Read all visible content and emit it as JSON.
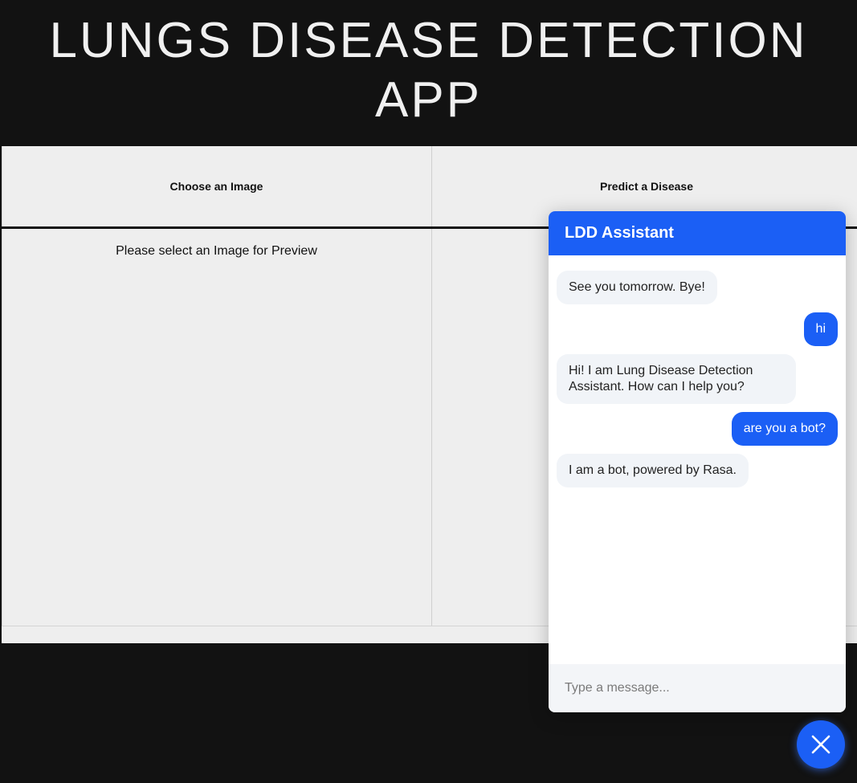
{
  "header": {
    "title_line1": "LUNGS DISEASE DETECTION",
    "title_line2": "APP"
  },
  "main": {
    "choose_label": "Choose an Image",
    "predict_label": "Predict a Disease",
    "preview_text": "Please select an Image for Preview"
  },
  "chat": {
    "title": "LDD Assistant",
    "messages": [
      {
        "sender": "bot",
        "text": "See you tomorrow. Bye!"
      },
      {
        "sender": "user",
        "text": "hi"
      },
      {
        "sender": "bot",
        "text": "Hi! I am Lung Disease Detection Assistant. How can I help you?"
      },
      {
        "sender": "user",
        "text": "are you a bot?"
      },
      {
        "sender": "bot",
        "text": "I am a bot, powered by Rasa."
      }
    ],
    "input_placeholder": "Type a message...",
    "accent_color": "#1b5ff5"
  },
  "fab": {
    "icon": "close-icon"
  }
}
